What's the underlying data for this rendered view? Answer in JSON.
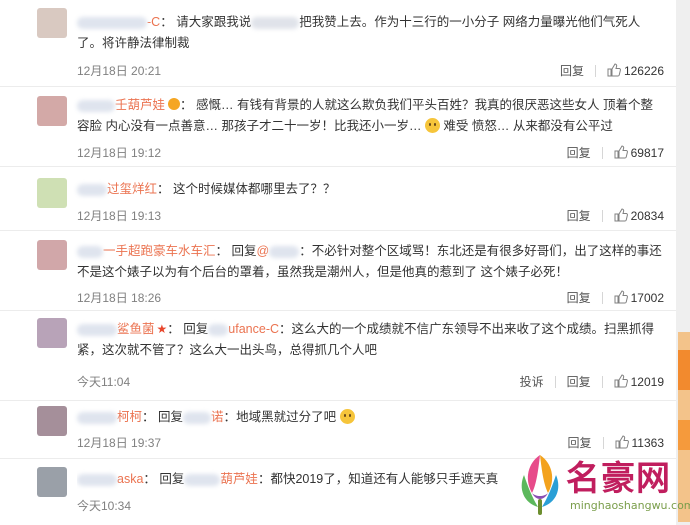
{
  "comments": [
    {
      "avatar_color": "#d9c9c1",
      "user": "-C",
      "colon": "：",
      "text_a": "请大家跟我说",
      "text_b": "把我赞上去。作为十三行的一小分子 网络力量曝光他们气死人了。将许静法律制裁",
      "time": "12月18日 20:21",
      "reply": "回复",
      "likes": "126226"
    },
    {
      "avatar_color": "#d3a9a7",
      "user": "...",
      "text": "感慨… 有钱有背景的人就这么欺负我们平头百姓？我真的很厌恶这些女人 顶着个整容脸 内心没有一点善意… 那孩子才二十一岁！比我还小一岁…",
      "text2": "难受 愤怒… 从来都没有公平过",
      "time": "12月18日 19:12",
      "reply": "回复",
      "likes": "69817"
    },
    {
      "avatar_color": "#cfe0b4",
      "user": "过玺烊红",
      "text": "这个时候媒体都哪里去了？？",
      "time": "12月18日 19:13",
      "reply": "回复",
      "likes": "20834"
    },
    {
      "avatar_color": "#d1a7a9",
      "user": "一手超跑豪车水车汇",
      "reply_prefix": "回复",
      "reply_at": "@",
      "text": "不必针对整个区域骂！东北还是有很多好哥们，出了这样的事还不是这个婊子以为有个后台的罩着，虽然我是潮州人，但是他真的惹到了 这个婊子必死！",
      "time": "12月18日 18:26",
      "reply": "回复",
      "likes": "17002"
    },
    {
      "avatar_color": "#b8a3b8",
      "user": "鲨鱼菌",
      "reply_prefix": "回复",
      "reply_target": "ufance-C",
      "text": "这么大的一个成绩就不信广东领导不出来收了这个成绩。扫黑抓得紧，这次就不管了？这么大一出头鸟，总得抓几个人吧",
      "time": "今天11:04",
      "report": "投诉",
      "reply": "回复",
      "likes": "12019"
    },
    {
      "avatar_color": "#a58f9a",
      "user": "柯柯",
      "reply_prefix": "回复",
      "reply_target": "诺",
      "text": "地域黑就过分了吧",
      "time": "12月18日 19:37",
      "reply": "回复",
      "likes": "11363"
    },
    {
      "avatar_color": "#9aa0a8",
      "user": "aska",
      "reply_prefix": "回复",
      "reply_target": "葫芦娃",
      "text": "都快2019了，知道还有人能够只手遮天真",
      "time": "今天10:34",
      "reply": "回复",
      "likes": ""
    }
  ],
  "watermark": {
    "text": "名豪网",
    "url": "minghaoshangwu.com"
  },
  "colors": {
    "username": "#eb7350",
    "meta": "#808080",
    "watermark": "#c01e5e"
  }
}
